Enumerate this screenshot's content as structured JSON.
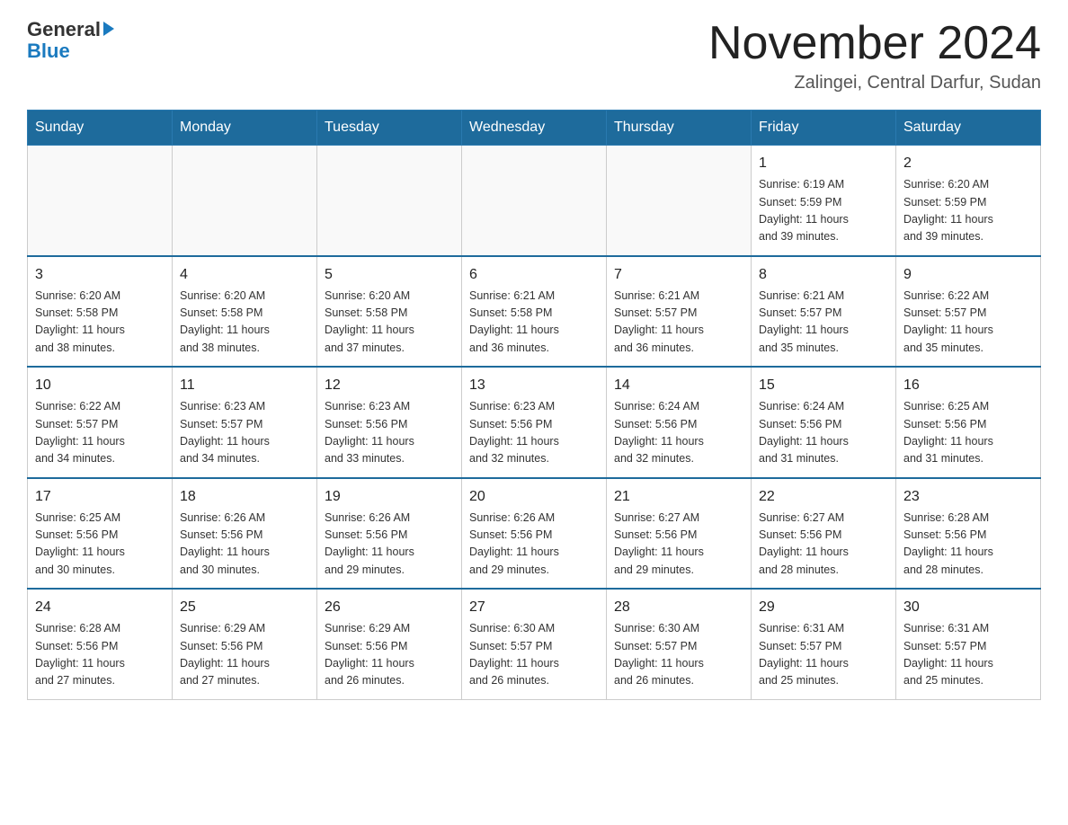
{
  "logo": {
    "general": "General",
    "blue": "Blue"
  },
  "header": {
    "title": "November 2024",
    "location": "Zalingei, Central Darfur, Sudan"
  },
  "days_of_week": [
    "Sunday",
    "Monday",
    "Tuesday",
    "Wednesday",
    "Thursday",
    "Friday",
    "Saturday"
  ],
  "weeks": [
    [
      {
        "day": "",
        "info": ""
      },
      {
        "day": "",
        "info": ""
      },
      {
        "day": "",
        "info": ""
      },
      {
        "day": "",
        "info": ""
      },
      {
        "day": "",
        "info": ""
      },
      {
        "day": "1",
        "info": "Sunrise: 6:19 AM\nSunset: 5:59 PM\nDaylight: 11 hours\nand 39 minutes."
      },
      {
        "day": "2",
        "info": "Sunrise: 6:20 AM\nSunset: 5:59 PM\nDaylight: 11 hours\nand 39 minutes."
      }
    ],
    [
      {
        "day": "3",
        "info": "Sunrise: 6:20 AM\nSunset: 5:58 PM\nDaylight: 11 hours\nand 38 minutes."
      },
      {
        "day": "4",
        "info": "Sunrise: 6:20 AM\nSunset: 5:58 PM\nDaylight: 11 hours\nand 38 minutes."
      },
      {
        "day": "5",
        "info": "Sunrise: 6:20 AM\nSunset: 5:58 PM\nDaylight: 11 hours\nand 37 minutes."
      },
      {
        "day": "6",
        "info": "Sunrise: 6:21 AM\nSunset: 5:58 PM\nDaylight: 11 hours\nand 36 minutes."
      },
      {
        "day": "7",
        "info": "Sunrise: 6:21 AM\nSunset: 5:57 PM\nDaylight: 11 hours\nand 36 minutes."
      },
      {
        "day": "8",
        "info": "Sunrise: 6:21 AM\nSunset: 5:57 PM\nDaylight: 11 hours\nand 35 minutes."
      },
      {
        "day": "9",
        "info": "Sunrise: 6:22 AM\nSunset: 5:57 PM\nDaylight: 11 hours\nand 35 minutes."
      }
    ],
    [
      {
        "day": "10",
        "info": "Sunrise: 6:22 AM\nSunset: 5:57 PM\nDaylight: 11 hours\nand 34 minutes."
      },
      {
        "day": "11",
        "info": "Sunrise: 6:23 AM\nSunset: 5:57 PM\nDaylight: 11 hours\nand 34 minutes."
      },
      {
        "day": "12",
        "info": "Sunrise: 6:23 AM\nSunset: 5:56 PM\nDaylight: 11 hours\nand 33 minutes."
      },
      {
        "day": "13",
        "info": "Sunrise: 6:23 AM\nSunset: 5:56 PM\nDaylight: 11 hours\nand 32 minutes."
      },
      {
        "day": "14",
        "info": "Sunrise: 6:24 AM\nSunset: 5:56 PM\nDaylight: 11 hours\nand 32 minutes."
      },
      {
        "day": "15",
        "info": "Sunrise: 6:24 AM\nSunset: 5:56 PM\nDaylight: 11 hours\nand 31 minutes."
      },
      {
        "day": "16",
        "info": "Sunrise: 6:25 AM\nSunset: 5:56 PM\nDaylight: 11 hours\nand 31 minutes."
      }
    ],
    [
      {
        "day": "17",
        "info": "Sunrise: 6:25 AM\nSunset: 5:56 PM\nDaylight: 11 hours\nand 30 minutes."
      },
      {
        "day": "18",
        "info": "Sunrise: 6:26 AM\nSunset: 5:56 PM\nDaylight: 11 hours\nand 30 minutes."
      },
      {
        "day": "19",
        "info": "Sunrise: 6:26 AM\nSunset: 5:56 PM\nDaylight: 11 hours\nand 29 minutes."
      },
      {
        "day": "20",
        "info": "Sunrise: 6:26 AM\nSunset: 5:56 PM\nDaylight: 11 hours\nand 29 minutes."
      },
      {
        "day": "21",
        "info": "Sunrise: 6:27 AM\nSunset: 5:56 PM\nDaylight: 11 hours\nand 29 minutes."
      },
      {
        "day": "22",
        "info": "Sunrise: 6:27 AM\nSunset: 5:56 PM\nDaylight: 11 hours\nand 28 minutes."
      },
      {
        "day": "23",
        "info": "Sunrise: 6:28 AM\nSunset: 5:56 PM\nDaylight: 11 hours\nand 28 minutes."
      }
    ],
    [
      {
        "day": "24",
        "info": "Sunrise: 6:28 AM\nSunset: 5:56 PM\nDaylight: 11 hours\nand 27 minutes."
      },
      {
        "day": "25",
        "info": "Sunrise: 6:29 AM\nSunset: 5:56 PM\nDaylight: 11 hours\nand 27 minutes."
      },
      {
        "day": "26",
        "info": "Sunrise: 6:29 AM\nSunset: 5:56 PM\nDaylight: 11 hours\nand 26 minutes."
      },
      {
        "day": "27",
        "info": "Sunrise: 6:30 AM\nSunset: 5:57 PM\nDaylight: 11 hours\nand 26 minutes."
      },
      {
        "day": "28",
        "info": "Sunrise: 6:30 AM\nSunset: 5:57 PM\nDaylight: 11 hours\nand 26 minutes."
      },
      {
        "day": "29",
        "info": "Sunrise: 6:31 AM\nSunset: 5:57 PM\nDaylight: 11 hours\nand 25 minutes."
      },
      {
        "day": "30",
        "info": "Sunrise: 6:31 AM\nSunset: 5:57 PM\nDaylight: 11 hours\nand 25 minutes."
      }
    ]
  ]
}
